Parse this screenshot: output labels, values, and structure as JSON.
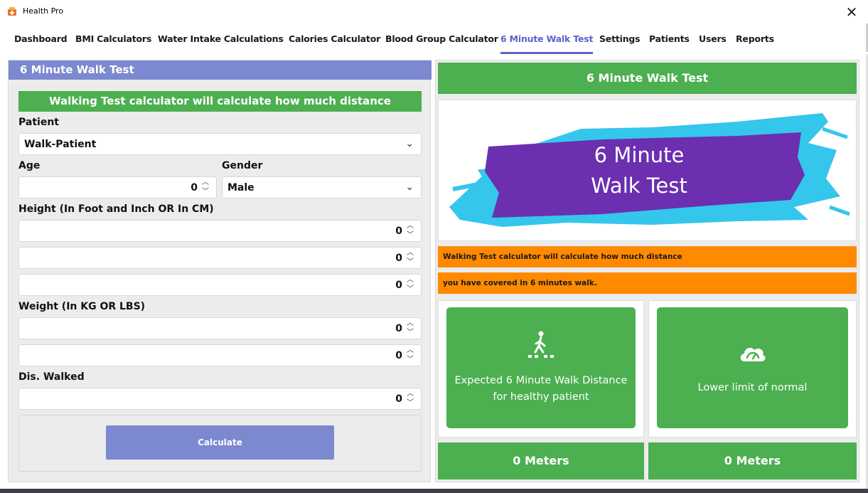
{
  "window": {
    "title": "Health Pro",
    "close_glyph": "✕"
  },
  "tabs": [
    {
      "label": "Dashboard"
    },
    {
      "label": "BMI Calculators"
    },
    {
      "label": "Water Intake Calculations"
    },
    {
      "label": "Calories Calculator"
    },
    {
      "label": "Blood Group Calculator"
    },
    {
      "label": "6 Minute Walk Test"
    },
    {
      "label": "Settings"
    },
    {
      "label": "Patients"
    },
    {
      "label": "Users"
    },
    {
      "label": "Reports"
    }
  ],
  "form": {
    "header": "6 Minute Walk Test",
    "banner": "Walking Test calculator will calculate how much distance",
    "patient_label": "Patient",
    "patient_value": "Walk-Patient",
    "age_label": "Age",
    "age_value": "0",
    "gender_label": "Gender",
    "gender_value": "Male",
    "height_label": "Height (In Foot and Inch OR In CM)",
    "height_values": [
      "0",
      "0",
      "0"
    ],
    "weight_label": "Weight (In KG OR LBS)",
    "weight_values": [
      "0",
      "0"
    ],
    "distance_label": "Dis. Walked",
    "distance_value": "0",
    "calculate_label": "Calculate"
  },
  "result_panel": {
    "header": "6 Minute Walk Test",
    "hero_line1": "6 Minute",
    "hero_line2": "Walk Test",
    "info_line1": "Walking Test calculator will calculate how much distance",
    "info_line2": "you have covered in 6 minutes walk.",
    "card1_line1": "Expected 6 Minute Walk Distance",
    "card1_line2": "for healthy patient",
    "card2_text": "Lower limit of normal",
    "result1": "0 Meters",
    "result2": "0 Meters"
  },
  "colors": {
    "accent": "#5b63c8",
    "header_blue": "#7c88cf",
    "green": "#4caf50",
    "orange": "#ff8a00",
    "hero_purple": "#6b2fb0",
    "hero_cyan": "#35c6ec"
  },
  "icons": [
    "app-icon",
    "close-icon",
    "chevron-down-icon",
    "spin-up-icon",
    "spin-down-icon",
    "pedestrian-crossing-icon",
    "cloud-speedometer-icon"
  ]
}
